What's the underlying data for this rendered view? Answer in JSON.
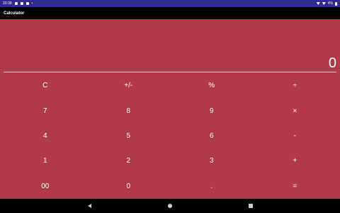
{
  "status_bar": {
    "time": "20:39",
    "icons": [
      "notification-icon",
      "notification-icon",
      "notification-icon",
      "dot-icon",
      "wifi-icon",
      "signal-icon",
      "battery-icon"
    ],
    "battery": "4%"
  },
  "app_bar": {
    "title": "Calculator"
  },
  "display": {
    "value": "0"
  },
  "keypad": {
    "rows": [
      [
        "C",
        "+/-",
        "%",
        "÷"
      ],
      [
        "7",
        "8",
        "9",
        "×"
      ],
      [
        "4",
        "5",
        "6",
        "-"
      ],
      [
        "1",
        "2",
        "3",
        "+"
      ],
      [
        "00",
        "0",
        ".",
        "="
      ]
    ]
  },
  "nav_bar": {
    "icons": [
      "back-icon",
      "home-icon",
      "recents-icon"
    ]
  },
  "colors": {
    "background": "#b23a48",
    "status_bar": "#2f2b90",
    "app_bar": "#000000",
    "text": "#ffffff"
  }
}
